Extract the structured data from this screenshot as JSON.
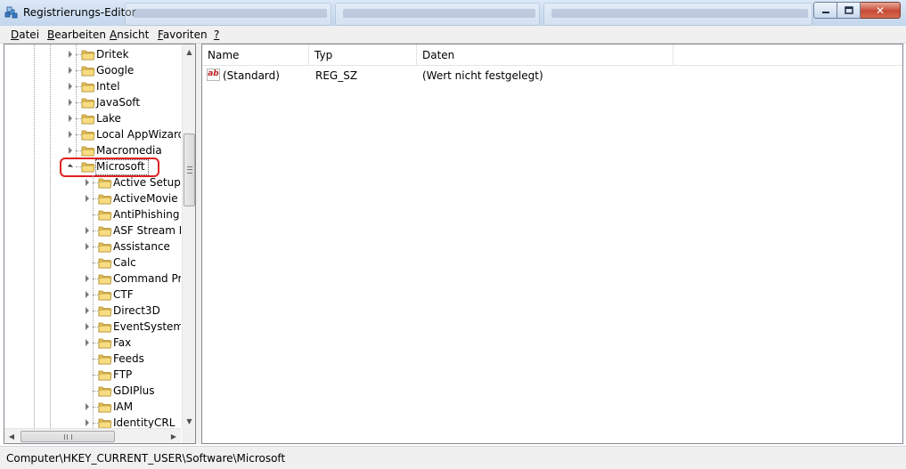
{
  "window": {
    "title": "Registrierungs-Editor",
    "close_glyph": "✕",
    "colors": {
      "highlight_ring": "#e02020",
      "close_button": "#c74a34"
    }
  },
  "menu": {
    "items": [
      {
        "label": "Datei",
        "accel": "D"
      },
      {
        "label": "Bearbeiten",
        "accel": "B"
      },
      {
        "label": "Ansicht",
        "accel": "A"
      },
      {
        "label": "Favoriten",
        "accel": "F"
      },
      {
        "label": "?",
        "accel": "?"
      }
    ]
  },
  "tree": {
    "items": [
      {
        "label": "Dritek",
        "level": 1,
        "expander": "collapsed"
      },
      {
        "label": "Google",
        "level": 1,
        "expander": "collapsed"
      },
      {
        "label": "Intel",
        "level": 1,
        "expander": "collapsed"
      },
      {
        "label": "JavaSoft",
        "level": 1,
        "expander": "collapsed"
      },
      {
        "label": "Lake",
        "level": 1,
        "expander": "collapsed"
      },
      {
        "label": "Local AppWizard-",
        "level": 1,
        "expander": "collapsed"
      },
      {
        "label": "Macromedia",
        "level": 1,
        "expander": "collapsed"
      },
      {
        "label": "Microsoft",
        "level": 1,
        "expander": "expanded",
        "selected": true
      },
      {
        "label": "Active Setup",
        "level": 2,
        "expander": "collapsed"
      },
      {
        "label": "ActiveMovie",
        "level": 2,
        "expander": "collapsed"
      },
      {
        "label": "AntiPhishing",
        "level": 2,
        "expander": "none"
      },
      {
        "label": "ASF Stream De",
        "level": 2,
        "expander": "collapsed"
      },
      {
        "label": "Assistance",
        "level": 2,
        "expander": "collapsed"
      },
      {
        "label": "Calc",
        "level": 2,
        "expander": "none"
      },
      {
        "label": "Command Pro",
        "level": 2,
        "expander": "collapsed"
      },
      {
        "label": "CTF",
        "level": 2,
        "expander": "collapsed"
      },
      {
        "label": "Direct3D",
        "level": 2,
        "expander": "collapsed"
      },
      {
        "label": "EventSystem",
        "level": 2,
        "expander": "collapsed"
      },
      {
        "label": "Fax",
        "level": 2,
        "expander": "collapsed"
      },
      {
        "label": "Feeds",
        "level": 2,
        "expander": "none"
      },
      {
        "label": "FTP",
        "level": 2,
        "expander": "none"
      },
      {
        "label": "GDIPlus",
        "level": 2,
        "expander": "none"
      },
      {
        "label": "IAM",
        "level": 2,
        "expander": "collapsed"
      },
      {
        "label": "IdentityCRL",
        "level": 2,
        "expander": "collapsed"
      }
    ],
    "scroll_up_glyph": "▲",
    "scroll_down_glyph": "▼",
    "scroll_left_glyph": "◀",
    "scroll_right_glyph": "▶"
  },
  "list": {
    "columns": [
      "Name",
      "Typ",
      "Daten"
    ],
    "rows": [
      {
        "icon": "string-value-icon",
        "icon_text": "ab",
        "name": "(Standard)",
        "type": "REG_SZ",
        "data": "(Wert nicht festgelegt)"
      }
    ]
  },
  "status": {
    "path": "Computer\\HKEY_CURRENT_USER\\Software\\Microsoft"
  }
}
